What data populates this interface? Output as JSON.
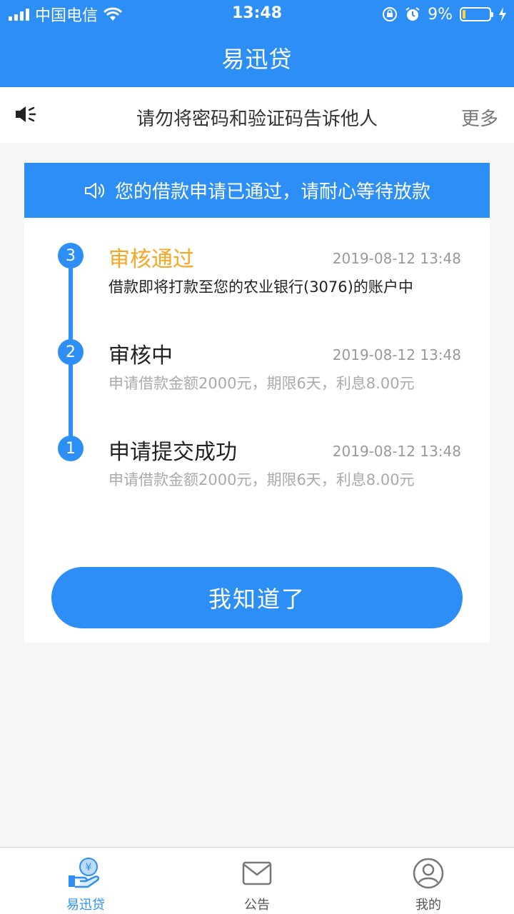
{
  "status_bar": {
    "carrier": "中国电信",
    "time": "13:48",
    "battery": "9%"
  },
  "header": {
    "title": "易迅贷"
  },
  "notice": {
    "text": "请勿将密码和验证码告诉他人",
    "more": "更多",
    "icon": "speaker-icon"
  },
  "card": {
    "banner": "您的借款申请已通过，请耐心等待放款",
    "steps": [
      {
        "number": "3",
        "title": "审核通过",
        "time": "2019-08-12 13:48",
        "desc": "借款即将打款至您的农业银行(3076)的账户中"
      },
      {
        "number": "2",
        "title": "审核中",
        "time": "2019-08-12 13:48",
        "desc": "申请借款金额2000元，期限6天，利息8.00元"
      },
      {
        "number": "1",
        "title": "申请提交成功",
        "time": "2019-08-12 13:48",
        "desc": "申请借款金额2000元，期限6天，利息8.00元"
      }
    ],
    "button": "我知道了"
  },
  "tabbar": {
    "items": [
      {
        "label": "易迅贷",
        "icon": "loan-hand-icon",
        "active": true
      },
      {
        "label": "公告",
        "icon": "mail-icon",
        "active": false
      },
      {
        "label": "我的",
        "icon": "user-icon",
        "active": false
      }
    ]
  },
  "colors": {
    "primary": "#2d8ff5",
    "highlight": "#f5a623",
    "background": "#f6f6f6"
  }
}
